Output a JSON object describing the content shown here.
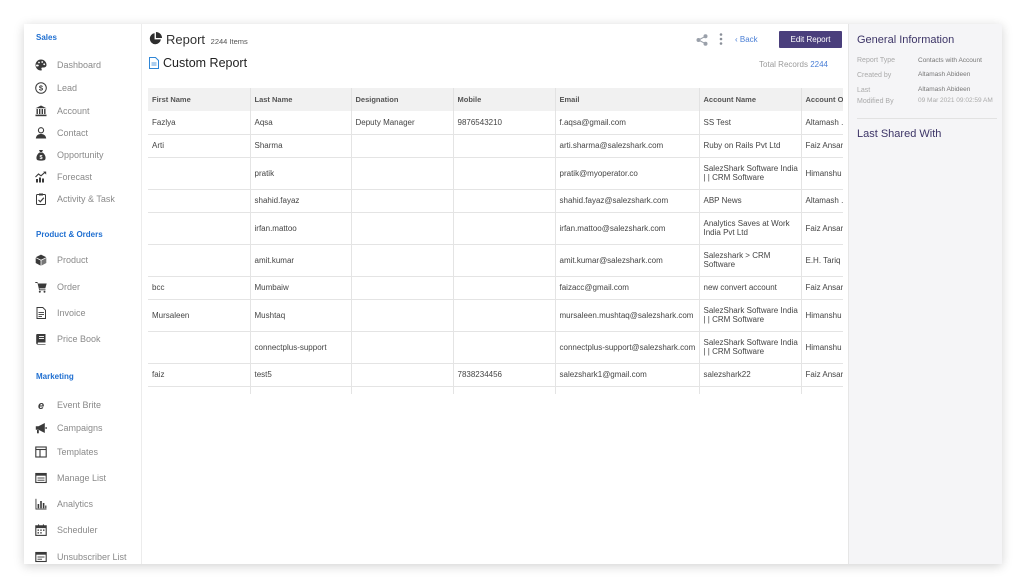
{
  "sidebar": {
    "sections": [
      {
        "title": "Sales",
        "items": [
          {
            "label": "Dashboard",
            "icon": "palette-icon"
          },
          {
            "label": "Lead",
            "icon": "dollar-circle-icon"
          },
          {
            "label": "Account",
            "icon": "bank-icon"
          },
          {
            "label": "Contact",
            "icon": "person-icon"
          },
          {
            "label": "Opportunity",
            "icon": "money-bag-icon"
          },
          {
            "label": "Forecast",
            "icon": "trend-chart-icon"
          },
          {
            "label": "Activity & Task",
            "icon": "clipboard-check-icon"
          }
        ]
      },
      {
        "title": "Product & Orders",
        "items": [
          {
            "label": "Product",
            "icon": "box-icon"
          },
          {
            "label": "Order",
            "icon": "cart-icon"
          },
          {
            "label": "Invoice",
            "icon": "invoice-icon"
          },
          {
            "label": "Price Book",
            "icon": "book-icon"
          }
        ]
      },
      {
        "title": "Marketing",
        "items": [
          {
            "label": "Event Brite",
            "icon": "eventbrite-icon"
          },
          {
            "label": "Campaigns",
            "icon": "megaphone-icon"
          },
          {
            "label": "Templates",
            "icon": "template-icon"
          },
          {
            "label": "Manage List",
            "icon": "list-icon"
          },
          {
            "label": "Analytics",
            "icon": "bar-chart-icon"
          },
          {
            "label": "Scheduler",
            "icon": "calendar-icon"
          },
          {
            "label": "Unsubscriber List",
            "icon": "unsubscribe-list-icon"
          }
        ]
      }
    ]
  },
  "header": {
    "title": "Report",
    "count": "2244 Items",
    "back_label": "Back",
    "edit_label": "Edit Report",
    "report_name": "Custom Report",
    "total_label": "Total Records",
    "total_value": "2244"
  },
  "table": {
    "columns": [
      "First Name",
      "Last Name",
      "Designation",
      "Mobile",
      "Email",
      "Account Name",
      "Account O"
    ],
    "rows": [
      {
        "h": "s",
        "cells": [
          "Fazlya",
          "Aqsa",
          "Deputy Manager",
          "9876543210",
          "f.aqsa@gmail.com",
          "SS Test",
          "Altamash ."
        ]
      },
      {
        "h": "s",
        "cells": [
          "Arti",
          "Sharma",
          "",
          "",
          "arti.sharma@salezshark.com",
          "Ruby on Rails Pvt Ltd",
          "Faiz Ansar"
        ]
      },
      {
        "h": "t",
        "cells": [
          "",
          "pratik",
          "",
          "",
          "pratik@myoperator.co",
          "SalezShark Software India | | CRM Software",
          "Himanshu"
        ]
      },
      {
        "h": "s",
        "cells": [
          "",
          "shahid.fayaz",
          "",
          "",
          "shahid.fayaz@salezshark.com",
          "ABP News",
          "Altamash ."
        ]
      },
      {
        "h": "t",
        "cells": [
          "",
          "irfan.mattoo",
          "",
          "",
          "irfan.mattoo@salezshark.com",
          "Analytics Saves at Work India Pvt Ltd",
          "Faiz Ansar"
        ]
      },
      {
        "h": "t",
        "cells": [
          "",
          "amit.kumar",
          "",
          "",
          "amit.kumar@salezshark.com",
          "Salezshark > CRM Software",
          "E.H. Tariq"
        ]
      },
      {
        "h": "s",
        "cells": [
          "bcc",
          "Mumbaiw",
          "",
          "",
          "faizacc@gmail.com",
          "new convert account",
          "Faiz Ansar"
        ]
      },
      {
        "h": "t",
        "cells": [
          "Mursaleen",
          "Mushtaq",
          "",
          "",
          "mursaleen.mushtaq@salezshark.com",
          "SalezShark Software India | | CRM Software",
          "Himanshu"
        ]
      },
      {
        "h": "t",
        "cells": [
          "",
          "connectplus-support",
          "",
          "",
          "connectplus-support@salezshark.com",
          "SalezShark Software India | | CRM Software",
          "Himanshu"
        ]
      },
      {
        "h": "s",
        "cells": [
          "faiz",
          "test5",
          "",
          "7838234456",
          "salezshark1@gmail.com",
          "salezshark22",
          "Faiz Ansar"
        ]
      }
    ]
  },
  "info": {
    "title": "General Information",
    "report_type_label": "Report Type",
    "report_type_value": "Contacts with Account",
    "created_by_label": "Created by",
    "created_by_value": "Altamash Abideen",
    "last_modified_label_1": "Last",
    "last_modified_label_2": "Modified By",
    "last_modified_by": "Altamash Abideen",
    "last_modified_date": "09 Mar 2021 09:02:59 AM",
    "last_shared_title": "Last Shared With"
  },
  "colors": {
    "accent": "#4a3f7c",
    "link": "#4a7fd6",
    "section": "#1f6fd1"
  }
}
